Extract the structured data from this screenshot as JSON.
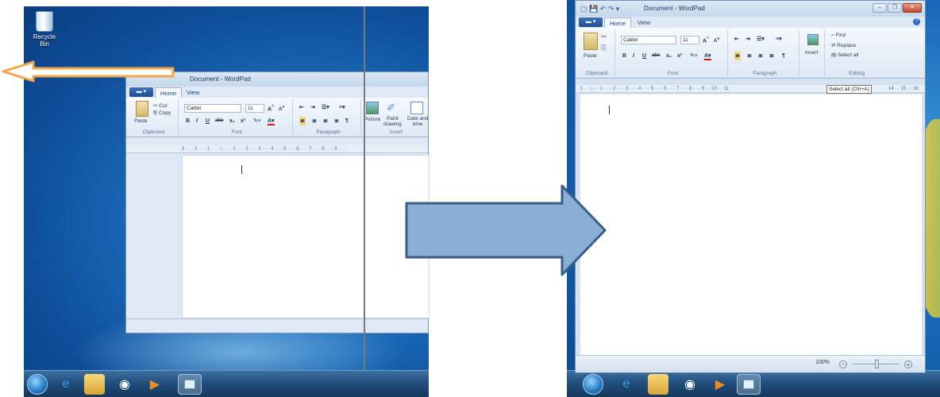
{
  "desktop_left": {
    "recycle_bin_label": "Recycle Bin"
  },
  "wordpad_left": {
    "title": "Document - WordPad",
    "tabs": [
      "Home",
      "View"
    ],
    "clipboard": {
      "paste": "Paste",
      "cut": "Cut",
      "copy": "Copy",
      "label": "Clipboard"
    },
    "font": {
      "family": "Calibri",
      "size": "11",
      "label": "Font"
    },
    "paragraph_label": "Paragraph",
    "insert": {
      "picture": "Picture",
      "paint_drawing": "Paint\ndrawing",
      "date_time": "Date and\ntime",
      "label": "Insert"
    },
    "ruler": "3 · · · 2 · · · 1 · · · ⌂ · · · 1 · · · 2 · · · 3 · · · 4 · · · 5 · · · 6 · · · 7 · · · 8 · · · 9 · · ·"
  },
  "wordpad_right": {
    "title": "Document - WordPad",
    "tabs": [
      "Home",
      "View"
    ],
    "clipboard": {
      "paste": "Paste",
      "label": "Clipboard"
    },
    "font": {
      "family": "Calibri",
      "size": "11",
      "label": "Font"
    },
    "paragraph_label": "Paragraph",
    "insert": {
      "insert": "Insert"
    },
    "editing": {
      "find": "Find",
      "replace": "Replace",
      "select_all": "Select all",
      "label": "Editing"
    },
    "ruler": "·1 · · ⌂ · · 1 · · · 2 · · · 3 · · · 4 · · · 5 · · · 6 · · · 7 · · · 8 · · · 9 · · 10 · · 11",
    "tooltip": "Select all (Ctrl+A)",
    "ruler_tail": "14 · · 15 · · 16",
    "zoom": "100%"
  },
  "colors": {
    "arrow_orange": "#f0a64a",
    "arrow_blue_fill": "#8aaed6",
    "arrow_blue_stroke": "#3b5d8a"
  }
}
